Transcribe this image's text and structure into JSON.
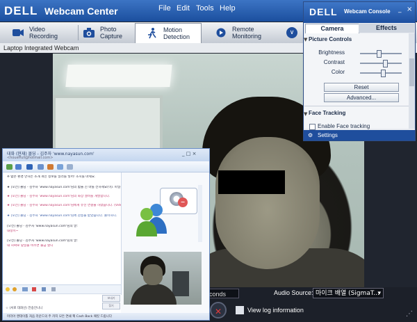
{
  "webcam_center": {
    "logo": "DELL",
    "title": "Webcam Center",
    "menu": [
      "File",
      "Edit",
      "Tools",
      "Help"
    ],
    "tabs": [
      {
        "line1": "Video",
        "line2": "Recording",
        "icon": "video-camera-icon"
      },
      {
        "line1": "Photo",
        "line2": "Capture",
        "icon": "photo-camera-icon"
      },
      {
        "line1": "Motion",
        "line2": "Detection",
        "icon": "running-person-icon"
      },
      {
        "line1": "Remote",
        "line2": "Monitoring",
        "icon": "remote-monitor-icon"
      }
    ],
    "active_tab": "Motion Detection",
    "subtitle": "Laptop Integrated Webcam",
    "seconds_field": "conds",
    "audio_source_label": "Audio Source:",
    "audio_source_value": "마이크 배열 (SigmaT...",
    "log_link": "View log information"
  },
  "webcam_console": {
    "logo": "DELL",
    "title": "Webcam Console",
    "minimize": "_",
    "close": "×",
    "tabs": [
      "Camera",
      "Effects"
    ],
    "section_picture": "Picture Controls",
    "controls": [
      {
        "label": "Brightness",
        "value": 0.45
      },
      {
        "label": "Contrast",
        "value": 0.62
      },
      {
        "label": "Color",
        "value": 0.55
      }
    ],
    "reset_button": "Reset",
    "advanced_button": "Advanced...",
    "section_face": "Face Tracking",
    "enable_face_tracking": "Enable Face tracking",
    "settings": "Settings"
  },
  "messenger": {
    "title": "대화 (현재) 몰딩 - 김주자 'www.nayasun.com'",
    "subtitle": "<houeffull@hotmail.com>",
    "window_controls": "_ □ ×",
    "chat_lines": [
      {
        "text": "※ 밤은 환경 안하는 소개 개인 정보를 일러를 넣어! 조치를 마세요.",
        "style": "normal"
      },
      {
        "text": "★ [오전] 몰딩 - 김주자 'www.nayasun.com'님의 밤을 친 마를 전하세요(이). 파일을 가져가시 받으 는 버사이에서 관 밤나고 이를 받습니다.",
        "style": "normal"
      },
      {
        "text": "  ★ [오전] 몰딩 - 김주자 'www.nayasun.com'님의 화상 설비를 개발합니다.",
        "style": "pink"
      },
      {
        "text": "★ [오전] 몰딩 - 김주자 'www.nayasun.com'님에게 유선 연결을 하였습니다. (Video+k)",
        "style": "pink"
      },
      {
        "text": "★ [오전] 몰딩 - 김주자 'www.nayasun.com'님께 감동을 받았습니다. 출이하니.",
        "style": "blue"
      },
      {
        "text": "[오전] 몰딩 - 김주자 'www.nayasun.com'님의 말:",
        "style": "normal"
      },
      {
        "text": "  내정이~",
        "style": "pink"
      },
      {
        "text": "[오전] 몰딩 - 김주자 'www.nayasun.com'님의 말:",
        "style": "normal"
      },
      {
        "text": "  내 허싸로 맞일을 비추면 불금 할니",
        "style": "pink"
      }
    ],
    "send_button": "보내기",
    "search_button": "찾기",
    "status_text": "☆ (서로 대화선) 전송안니니",
    "footer": "마리아 맨데이틀 처음 라운드의 주 카지 모든 연쇄 팩 Cash Back 패킷 드립니다"
  }
}
